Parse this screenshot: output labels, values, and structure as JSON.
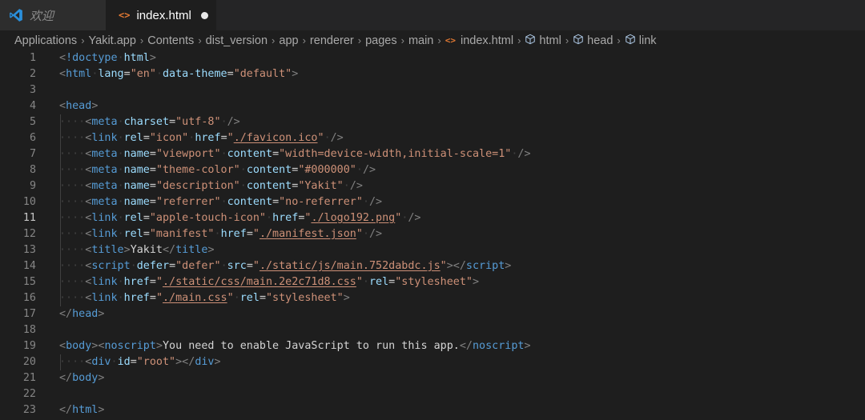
{
  "tabs": {
    "welcome": {
      "label": "欢迎",
      "icon": "vscode-logo-icon"
    },
    "active": {
      "label": "index.html",
      "icon": "html-file-icon",
      "modified": true
    }
  },
  "breadcrumb": [
    {
      "label": "Applications",
      "icon": null
    },
    {
      "label": "Yakit.app",
      "icon": null
    },
    {
      "label": "Contents",
      "icon": null
    },
    {
      "label": "dist_version",
      "icon": null
    },
    {
      "label": "app",
      "icon": null
    },
    {
      "label": "renderer",
      "icon": null
    },
    {
      "label": "pages",
      "icon": null
    },
    {
      "label": "main",
      "icon": null
    },
    {
      "label": "index.html",
      "icon": "html-file-icon"
    },
    {
      "label": "html",
      "icon": "cube-icon"
    },
    {
      "label": "head",
      "icon": "cube-icon"
    },
    {
      "label": "link",
      "icon": "cube-icon"
    }
  ],
  "editor": {
    "current_line": 11,
    "colors": {
      "background": "#1e1e1e",
      "tag": "#569cd6",
      "attribute": "#9cdcfe",
      "string": "#ce9178",
      "punctuation": "#808080",
      "text": "#d4d4d4",
      "line_number": "#858585",
      "file_icon": "#e37933"
    },
    "lines": [
      {
        "n": "1",
        "indent": 0,
        "tokens": [
          [
            "p",
            "<"
          ],
          [
            "tag",
            "!doctype"
          ],
          [
            "ws",
            "·"
          ],
          [
            "attr",
            "html"
          ],
          [
            "p",
            ">"
          ]
        ]
      },
      {
        "n": "2",
        "indent": 0,
        "tokens": [
          [
            "p",
            "<"
          ],
          [
            "tag",
            "html"
          ],
          [
            "ws",
            "·"
          ],
          [
            "attr",
            "lang"
          ],
          [
            "t",
            "="
          ],
          [
            "str",
            "\"en\""
          ],
          [
            "ws",
            "·"
          ],
          [
            "attr",
            "data-theme"
          ],
          [
            "t",
            "="
          ],
          [
            "str",
            "\"default\""
          ],
          [
            "p",
            ">"
          ]
        ]
      },
      {
        "n": "3",
        "indent": 0,
        "tokens": []
      },
      {
        "n": "4",
        "indent": 0,
        "tokens": [
          [
            "p",
            "<"
          ],
          [
            "tag",
            "head"
          ],
          [
            "p",
            ">"
          ]
        ]
      },
      {
        "n": "5",
        "indent": 1,
        "tokens": [
          [
            "ws",
            "····"
          ],
          [
            "p",
            "<"
          ],
          [
            "tag",
            "meta"
          ],
          [
            "ws",
            "·"
          ],
          [
            "attr",
            "charset"
          ],
          [
            "t",
            "="
          ],
          [
            "str",
            "\"utf-8\""
          ],
          [
            "ws",
            "·"
          ],
          [
            "p",
            "/>"
          ]
        ]
      },
      {
        "n": "6",
        "indent": 1,
        "tokens": [
          [
            "ws",
            "····"
          ],
          [
            "p",
            "<"
          ],
          [
            "tag",
            "link"
          ],
          [
            "ws",
            "·"
          ],
          [
            "attr",
            "rel"
          ],
          [
            "t",
            "="
          ],
          [
            "str",
            "\"icon\""
          ],
          [
            "ws",
            "·"
          ],
          [
            "attr",
            "href"
          ],
          [
            "t",
            "="
          ],
          [
            "str",
            "\""
          ],
          [
            "link",
            "./favicon.ico"
          ],
          [
            "str",
            "\""
          ],
          [
            "ws",
            "·"
          ],
          [
            "p",
            "/>"
          ]
        ]
      },
      {
        "n": "7",
        "indent": 1,
        "tokens": [
          [
            "ws",
            "····"
          ],
          [
            "p",
            "<"
          ],
          [
            "tag",
            "meta"
          ],
          [
            "ws",
            "·"
          ],
          [
            "attr",
            "name"
          ],
          [
            "t",
            "="
          ],
          [
            "str",
            "\"viewport\""
          ],
          [
            "ws",
            "·"
          ],
          [
            "attr",
            "content"
          ],
          [
            "t",
            "="
          ],
          [
            "str",
            "\"width=device-width,initial-scale=1\""
          ],
          [
            "ws",
            "·"
          ],
          [
            "p",
            "/>"
          ]
        ]
      },
      {
        "n": "8",
        "indent": 1,
        "tokens": [
          [
            "ws",
            "····"
          ],
          [
            "p",
            "<"
          ],
          [
            "tag",
            "meta"
          ],
          [
            "ws",
            "·"
          ],
          [
            "attr",
            "name"
          ],
          [
            "t",
            "="
          ],
          [
            "str",
            "\"theme-color\""
          ],
          [
            "ws",
            "·"
          ],
          [
            "attr",
            "content"
          ],
          [
            "t",
            "="
          ],
          [
            "str",
            "\"#000000\""
          ],
          [
            "ws",
            "·"
          ],
          [
            "p",
            "/>"
          ]
        ]
      },
      {
        "n": "9",
        "indent": 1,
        "tokens": [
          [
            "ws",
            "····"
          ],
          [
            "p",
            "<"
          ],
          [
            "tag",
            "meta"
          ],
          [
            "ws",
            "·"
          ],
          [
            "attr",
            "name"
          ],
          [
            "t",
            "="
          ],
          [
            "str",
            "\"description\""
          ],
          [
            "ws",
            "·"
          ],
          [
            "attr",
            "content"
          ],
          [
            "t",
            "="
          ],
          [
            "str",
            "\"Yakit\""
          ],
          [
            "ws",
            "·"
          ],
          [
            "p",
            "/>"
          ]
        ]
      },
      {
        "n": "10",
        "indent": 1,
        "tokens": [
          [
            "ws",
            "····"
          ],
          [
            "p",
            "<"
          ],
          [
            "tag",
            "meta"
          ],
          [
            "ws",
            "·"
          ],
          [
            "attr",
            "name"
          ],
          [
            "t",
            "="
          ],
          [
            "str",
            "\"referrer\""
          ],
          [
            "ws",
            "·"
          ],
          [
            "attr",
            "content"
          ],
          [
            "t",
            "="
          ],
          [
            "str",
            "\"no-referrer\""
          ],
          [
            "ws",
            "·"
          ],
          [
            "p",
            "/>"
          ]
        ]
      },
      {
        "n": "11",
        "indent": 1,
        "tokens": [
          [
            "ws",
            "····"
          ],
          [
            "p",
            "<"
          ],
          [
            "tag",
            "link"
          ],
          [
            "ws",
            "·"
          ],
          [
            "attr",
            "rel"
          ],
          [
            "t",
            "="
          ],
          [
            "str",
            "\"apple-touch-icon\""
          ],
          [
            "ws",
            "·"
          ],
          [
            "attr",
            "href"
          ],
          [
            "t",
            "="
          ],
          [
            "str",
            "\""
          ],
          [
            "link",
            "./logo192.png"
          ],
          [
            "str",
            "\""
          ],
          [
            "ws",
            "·"
          ],
          [
            "p",
            "/>"
          ]
        ]
      },
      {
        "n": "12",
        "indent": 1,
        "tokens": [
          [
            "ws",
            "····"
          ],
          [
            "p",
            "<"
          ],
          [
            "tag",
            "link"
          ],
          [
            "ws",
            "·"
          ],
          [
            "attr",
            "rel"
          ],
          [
            "t",
            "="
          ],
          [
            "str",
            "\"manifest\""
          ],
          [
            "ws",
            "·"
          ],
          [
            "attr",
            "href"
          ],
          [
            "t",
            "="
          ],
          [
            "str",
            "\""
          ],
          [
            "link",
            "./manifest.json"
          ],
          [
            "str",
            "\""
          ],
          [
            "ws",
            "·"
          ],
          [
            "p",
            "/>"
          ]
        ]
      },
      {
        "n": "13",
        "indent": 1,
        "tokens": [
          [
            "ws",
            "····"
          ],
          [
            "p",
            "<"
          ],
          [
            "tag",
            "title"
          ],
          [
            "p",
            ">"
          ],
          [
            "t",
            "Yakit"
          ],
          [
            "p",
            "</"
          ],
          [
            "tag",
            "title"
          ],
          [
            "p",
            ">"
          ]
        ]
      },
      {
        "n": "14",
        "indent": 1,
        "tokens": [
          [
            "ws",
            "····"
          ],
          [
            "p",
            "<"
          ],
          [
            "tag",
            "script"
          ],
          [
            "ws",
            "·"
          ],
          [
            "attr",
            "defer"
          ],
          [
            "t",
            "="
          ],
          [
            "str",
            "\"defer\""
          ],
          [
            "ws",
            "·"
          ],
          [
            "attr",
            "src"
          ],
          [
            "t",
            "="
          ],
          [
            "str",
            "\""
          ],
          [
            "link",
            "./static/js/main.752dabdc.js"
          ],
          [
            "str",
            "\""
          ],
          [
            "p",
            "></"
          ],
          [
            "tag",
            "script"
          ],
          [
            "p",
            ">"
          ]
        ]
      },
      {
        "n": "15",
        "indent": 1,
        "tokens": [
          [
            "ws",
            "····"
          ],
          [
            "p",
            "<"
          ],
          [
            "tag",
            "link"
          ],
          [
            "ws",
            "·"
          ],
          [
            "attr",
            "href"
          ],
          [
            "t",
            "="
          ],
          [
            "str",
            "\""
          ],
          [
            "link",
            "./static/css/main.2e2c71d8.css"
          ],
          [
            "str",
            "\""
          ],
          [
            "ws",
            "·"
          ],
          [
            "attr",
            "rel"
          ],
          [
            "t",
            "="
          ],
          [
            "str",
            "\"stylesheet\""
          ],
          [
            "p",
            ">"
          ]
        ]
      },
      {
        "n": "16",
        "indent": 1,
        "tokens": [
          [
            "ws",
            "····"
          ],
          [
            "p",
            "<"
          ],
          [
            "tag",
            "link"
          ],
          [
            "ws",
            "·"
          ],
          [
            "attr",
            "href"
          ],
          [
            "t",
            "="
          ],
          [
            "str",
            "\""
          ],
          [
            "link",
            "./main.css"
          ],
          [
            "str",
            "\""
          ],
          [
            "ws",
            "·"
          ],
          [
            "attr",
            "rel"
          ],
          [
            "t",
            "="
          ],
          [
            "str",
            "\"stylesheet\""
          ],
          [
            "p",
            ">"
          ]
        ]
      },
      {
        "n": "17",
        "indent": 0,
        "tokens": [
          [
            "p",
            "</"
          ],
          [
            "tag",
            "head"
          ],
          [
            "p",
            ">"
          ]
        ]
      },
      {
        "n": "18",
        "indent": 0,
        "tokens": []
      },
      {
        "n": "19",
        "indent": 0,
        "tokens": [
          [
            "p",
            "<"
          ],
          [
            "tag",
            "body"
          ],
          [
            "p",
            "><"
          ],
          [
            "tag",
            "noscript"
          ],
          [
            "p",
            ">"
          ],
          [
            "t",
            "You need to enable JavaScript to run this app."
          ],
          [
            "p",
            "</"
          ],
          [
            "tag",
            "noscript"
          ],
          [
            "p",
            ">"
          ]
        ]
      },
      {
        "n": "20",
        "indent": 1,
        "tokens": [
          [
            "ws",
            "····"
          ],
          [
            "p",
            "<"
          ],
          [
            "tag",
            "div"
          ],
          [
            "ws",
            "·"
          ],
          [
            "attr",
            "id"
          ],
          [
            "t",
            "="
          ],
          [
            "str",
            "\"root\""
          ],
          [
            "p",
            "></"
          ],
          [
            "tag",
            "div"
          ],
          [
            "p",
            ">"
          ]
        ]
      },
      {
        "n": "21",
        "indent": 0,
        "tokens": [
          [
            "p",
            "</"
          ],
          [
            "tag",
            "body"
          ],
          [
            "p",
            ">"
          ]
        ]
      },
      {
        "n": "22",
        "indent": 0,
        "tokens": []
      },
      {
        "n": "23",
        "indent": 0,
        "tokens": [
          [
            "p",
            "</"
          ],
          [
            "tag",
            "html"
          ],
          [
            "p",
            ">"
          ]
        ]
      }
    ]
  }
}
